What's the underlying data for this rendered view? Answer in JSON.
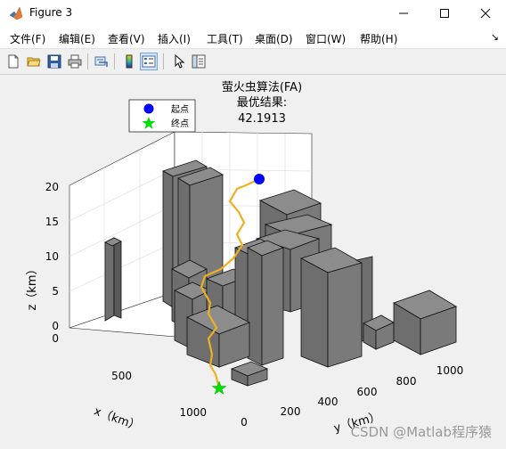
{
  "window": {
    "title": "Figure 3"
  },
  "menu": [
    "文件(F)",
    "编辑(E)",
    "查看(V)",
    "插入(I)",
    "工具(T)",
    "桌面(D)",
    "窗口(W)",
    "帮助(H)"
  ],
  "menu_overflow": "↘",
  "toolbar": [
    "new-figure-icon",
    "open-icon",
    "save-icon",
    "print-icon",
    "link-icon",
    "colorbar-icon",
    "legend-icon",
    "pointer-icon",
    "property-editor-icon"
  ],
  "plot": {
    "title_line1": "萤火虫算法(FA)",
    "title_line2": "最优结果:",
    "title_line3": "42.1913",
    "legend": [
      {
        "label": "起点",
        "marker": "circle",
        "color": "#0000ff"
      },
      {
        "label": "终点",
        "marker": "star",
        "color": "#00e000"
      }
    ],
    "xlabel": "x（km）",
    "ylabel": "y（km）",
    "zlabel": "z（km）",
    "x_ticks": [
      "0",
      "500",
      "1000"
    ],
    "y_ticks": [
      "0",
      "200",
      "400",
      "600",
      "800",
      "1000"
    ],
    "z_ticks": [
      "0",
      "5",
      "10",
      "15",
      "20"
    ],
    "path_color": "#edb120",
    "building_color": "#808080"
  },
  "watermark": "CSDN @Matlab程序猿",
  "chart_data": {
    "type": "line",
    "title": "萤火虫算法(FA) 最优结果: 42.1913",
    "xlabel": "x（km）",
    "ylabel": "y（km）",
    "zlabel": "z（km）",
    "xlim": [
      0,
      1000
    ],
    "ylim": [
      0,
      1000
    ],
    "zlim": [
      0,
      20
    ],
    "series": [
      {
        "name": "起点",
        "points": [
          [
            0,
            1000,
            20
          ]
        ]
      },
      {
        "name": "终点",
        "points": [
          [
            1000,
            0,
            0
          ]
        ]
      }
    ]
  }
}
